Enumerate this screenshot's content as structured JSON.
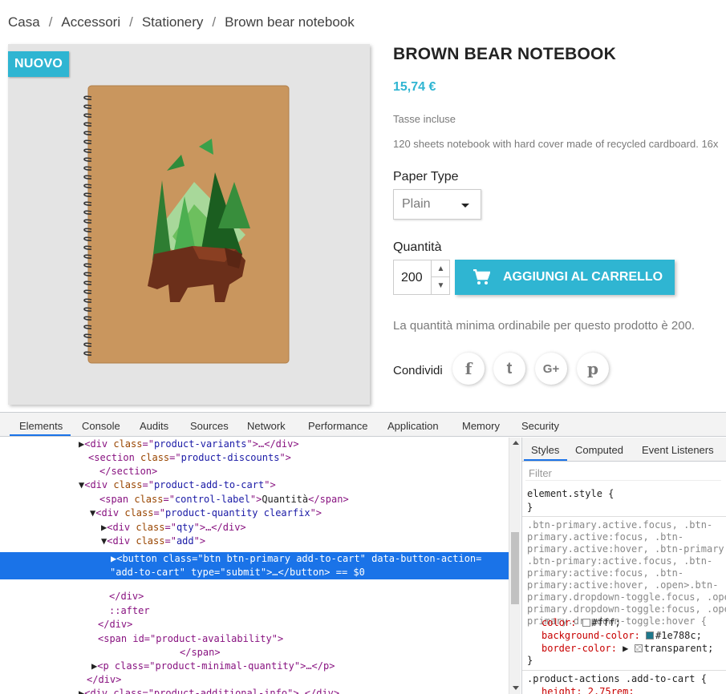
{
  "breadcrumb": [
    "Casa",
    "Accessori",
    "Stationery",
    "Brown bear notebook"
  ],
  "badge": "NUOVO",
  "product": {
    "title": "BROWN BEAR NOTEBOOK",
    "price": "15,74 €",
    "tax": "Tasse incluse",
    "description": "120 sheets notebook with hard cover made of recycled cardboard. 16x",
    "paper_type_label": "Paper Type",
    "paper_type_value": "Plain",
    "quantity_label": "Quantità",
    "quantity_value": "200",
    "add_to_cart": "AGGIUNGI AL CARRELLO",
    "min_quantity": "La quantità minima ordinabile per questo prodotto è 200.",
    "share_label": "Condividi",
    "share": [
      "f",
      "t",
      "G+",
      "p"
    ]
  },
  "colors": {
    "accent": "#2fb5d2",
    "devtools_selection": "#1a73e8"
  },
  "devtools": {
    "tabs": [
      "Elements",
      "Console",
      "Audits",
      "Sources",
      "Network",
      "Performance",
      "Application",
      "Memory",
      "Security"
    ],
    "active_tab": "Elements",
    "style_tabs": [
      "Styles",
      "Computed",
      "Event Listeners"
    ],
    "filter_placeholder": "Filter",
    "dom": [
      {
        "arrow": "▶",
        "open": "<div ",
        "attrs": [
          [
            "class",
            "product-variants"
          ]
        ],
        "close": ">…</div>"
      },
      {
        "arrow": "",
        "open": "<section ",
        "attrs": [
          [
            "class",
            "product-discounts"
          ]
        ],
        "close": ">"
      },
      {
        "arrow": "",
        "open": "</section>",
        "attrs": [],
        "close": ""
      },
      {
        "arrow": "▼",
        "open": "<div ",
        "attrs": [
          [
            "class",
            "product-add-to-cart"
          ]
        ],
        "close": ">"
      },
      {
        "arrow": "",
        "open": "<span ",
        "attrs": [
          [
            "class",
            "control-label"
          ]
        ],
        "close": ">",
        "text": "Quantità",
        "end": "</span>"
      },
      {
        "arrow": "▼",
        "open": "<div ",
        "attrs": [
          [
            "class",
            "product-quantity clearfix"
          ]
        ],
        "close": ">"
      },
      {
        "arrow": "▶",
        "open": "<div ",
        "attrs": [
          [
            "class",
            "qty"
          ]
        ],
        "close": ">…</div>"
      },
      {
        "arrow": "▼",
        "open": "<div ",
        "attrs": [
          [
            "class",
            "add"
          ]
        ],
        "close": ">"
      }
    ],
    "selected_line1": "<button class=\"btn btn-primary add-to-cart\" data-button-action=",
    "selected_line2": "\"add-to-cart\" type=\"submit\">…</button> == $0",
    "dom_after": [
      {
        "text": "</div>"
      },
      {
        "text": "::after"
      },
      {
        "text": "</div>"
      },
      {
        "text": "<span id=\"product-availability\">"
      },
      {
        "text": "</span>"
      },
      {
        "text": "<p class=\"product-minimal-quantity\">…</p>"
      },
      {
        "text": "</div>"
      },
      {
        "text": "<div class=\"product-additional-info\">…</div>"
      }
    ],
    "styles": {
      "element_style": "element.style {",
      "close_brace": "}",
      "selector_lines": [
        ".btn-primary.active.focus, .btn-",
        "primary.active:focus, .btn-",
        "primary.active:hover, .btn-primary",
        ".btn-primary:active.focus, .btn-",
        "primary:active:focus, .btn-",
        "primary:active:hover, .open>.btn-",
        "primary.dropdown-toggle.focus, .ope",
        "primary.dropdown-toggle:focus, .ope",
        "primary.dropdown-toggle:hover {"
      ],
      "props": [
        {
          "name": "color",
          "value": "#fff",
          "swatch": "#ffffff"
        },
        {
          "name": "background-color",
          "value": "#1e788c",
          "swatch": "#1e788c"
        },
        {
          "name": "border-color",
          "value": "transparent",
          "swatch": "checker"
        }
      ],
      "next_rule": ".product-actions .add-to-cart {",
      "next_prop": "height: 2.75rem;"
    }
  }
}
